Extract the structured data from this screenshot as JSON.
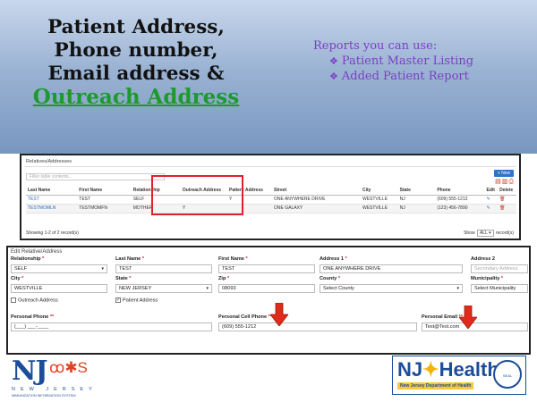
{
  "slide": {
    "headline_lines": [
      "Patient Address,",
      "Phone number,",
      "Email address &"
    ],
    "headline_highlight": "Outreach Address",
    "reports_title": "Reports you can use:",
    "reports_items": [
      "Patient Master Listing",
      "Added Patient Report"
    ],
    "reports_bullet": "❖"
  },
  "relatives": {
    "title": "Relatives/Addresses",
    "filter_placeholder": "Filter table contents...",
    "new_button": "+ New",
    "columns": [
      "Last Name",
      "First Name",
      "Relationship",
      "Outreach Address",
      "Patient Address",
      "Street",
      "City",
      "State",
      "Phone",
      "Edit",
      "Delete"
    ],
    "rows": [
      {
        "last": "TEST",
        "first": "TEST",
        "relationship": "SELF",
        "outreach": "",
        "patient": "Y",
        "street": "ONE ANYWHERE DRIVE",
        "city": "WESTVILLE",
        "state": "NJ",
        "phone": "(609) 555-1212"
      },
      {
        "last": "TESTMOMLN",
        "first": "TESTMOMFN",
        "relationship": "MOTHER",
        "outreach": "Y",
        "patient": "",
        "street": "ONE GALAXY",
        "city": "WESTVILLE",
        "state": "NJ",
        "phone": "(123) 456-7890"
      }
    ],
    "showing": "Showing 1-2 of 2 record(s)",
    "show_label": "Show",
    "show_value": "ALL ▾",
    "show_suffix": "record(s)"
  },
  "edit": {
    "title": "Edit Relative/Address",
    "relationship_label": "Relationship",
    "relationship_value": "SELF",
    "last_name_label": "Last Name",
    "last_name_value": "TEST",
    "first_name_label": "First Name",
    "first_name_value": "TEST",
    "address1_label": "Address 1",
    "address1_value": "ONE ANYWHERE DRIVE",
    "address2_label": "Address 2",
    "address2_placeholder": "Secondary Address",
    "city_label": "City",
    "city_value": "WESTVILLE",
    "state_label": "State",
    "state_value": "NEW JERSEY",
    "zip_label": "Zip",
    "zip_value": "08093",
    "county_label": "County",
    "county_value": "Select County",
    "municipality_label": "Municipality",
    "municipality_value": "Select Municipality",
    "outreach_label": "Outreach Address",
    "outreach_checked": false,
    "patient_label": "Patient Address",
    "patient_checked": true,
    "personal_phone_label": "Personal Phone",
    "personal_phone_value": "(___) ___-____",
    "cell_phone_label": "Personal Cell Phone",
    "cell_phone_value": "(609) 555-1212",
    "email_label": "Personal Email",
    "email_value": "Test@Test.com",
    "required_mark": "*",
    "double_mark": "**"
  },
  "logos": {
    "njiis_big": "NJ",
    "njiis_figs": "ꝏ✱S",
    "njiis_sub": "NEW JERSEY",
    "njiis_sub2": "IMMUNIZATION INFORMATION SYSTEM",
    "njh_word": "Health",
    "njh_nj": "NJ",
    "njh_line": "New Jersey Department of Health",
    "njh_seal": "SEAL"
  },
  "colors": {
    "headline_green": "#1c9a2c",
    "reports_purple": "#7b3fc7",
    "highlight_red": "#e0202a",
    "arrow_red": "#e02a1a"
  }
}
